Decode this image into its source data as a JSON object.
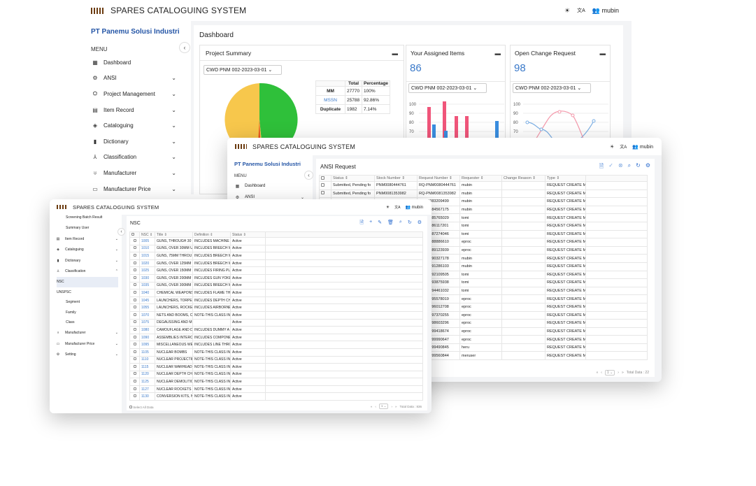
{
  "app": {
    "title": "SPARES CATALOGUING SYSTEM",
    "user": "mubin",
    "theme_icon": "☀",
    "lang_icon": "文A",
    "company": "PT Panemu Solusi Industri",
    "menu_label": "MENU"
  },
  "win1": {
    "page_title": "Dashboard",
    "sidebar": [
      {
        "label": "Dashboard",
        "icon": "▦"
      },
      {
        "label": "ANSI",
        "icon": "⚙",
        "chev": "⌄"
      },
      {
        "label": "Project Management",
        "icon": "⛭",
        "chev": "⌄"
      },
      {
        "label": "Item Record",
        "icon": "▤",
        "chev": "⌄"
      },
      {
        "label": "Cataloguing",
        "icon": "◈",
        "chev": "⌄"
      },
      {
        "label": "Dictionary",
        "icon": "▮",
        "chev": "⌄"
      },
      {
        "label": "Classification",
        "icon": "⅄",
        "chev": "⌄"
      },
      {
        "label": "Manufacturer",
        "icon": "♅",
        "chev": "⌄"
      },
      {
        "label": "Manufacturer Price",
        "icon": "▭",
        "chev": "⌄"
      }
    ],
    "project_summary": {
      "title": "Project Summary",
      "select": "CWO PNM 002-2023-03-01",
      "table": {
        "headers": [
          "",
          "Total",
          "Percentage"
        ],
        "rows": [
          [
            "MM",
            "27770",
            "100%"
          ],
          [
            "MSSN",
            "25788",
            "92.86%"
          ],
          [
            "Duplicate",
            "1982",
            "7.14%"
          ]
        ]
      },
      "pie": {
        "values": [
          92.86,
          7.14
        ],
        "colors": [
          "#2fc03a",
          "#f7c74c"
        ]
      }
    },
    "assigned": {
      "title": "Your Assigned Items",
      "count": "86",
      "select": "CWO PNM 002-2023-03-01",
      "yticks": [
        "100",
        "90",
        "80",
        "70",
        "60",
        "50"
      ]
    },
    "change": {
      "title": "Open Change Request",
      "count": "98",
      "select": "CWO PNM 002-2023-03-01",
      "yticks": [
        "100",
        "90",
        "80",
        "70",
        "60",
        "50"
      ]
    }
  },
  "win2": {
    "sidebar": [
      {
        "label": "Dashboard",
        "icon": "▦"
      },
      {
        "label": "ANSI",
        "icon": "⚙",
        "chev": "⌄"
      }
    ],
    "title": "ANSI Request",
    "toolbar": [
      "doc-icon",
      "check-icon",
      "cancel-icon",
      "search-icon",
      "refresh-icon",
      "settings-icon"
    ],
    "headers": [
      "",
      "Status",
      "Stock Number",
      "Request Number",
      "Requester",
      "Change Reason",
      "Type"
    ],
    "rows": [
      [
        "Submitted, Pending fo",
        "PNM0080444761",
        "RQ-PNM0080444761",
        "mubin",
        "",
        "REQUEST CREATE MA"
      ],
      [
        "Submitted, Pending fo",
        "PNM0081353982",
        "RQ-PNM0081353982",
        "mubin",
        "",
        "REQUEST CREATE MA"
      ],
      [
        "",
        "",
        "PNM0083209499",
        "mubin",
        "",
        "REQUEST CREATE MA"
      ],
      [
        "",
        "",
        "PNM0084567175",
        "mubin",
        "",
        "REQUEST CREATE MA"
      ],
      [
        "",
        "",
        "PNM0085765029",
        "tomi",
        "",
        "REQUEST CREATE MA"
      ],
      [
        "",
        "",
        "PNM0086117201",
        "tomi",
        "",
        "REQUEST CREATE MA"
      ],
      [
        "",
        "",
        "PNM0087274046",
        "tomi",
        "",
        "REQUEST CREATE MA"
      ],
      [
        "",
        "",
        "PNM0088886610",
        "eproc",
        "",
        "REQUEST CREATE MA"
      ],
      [
        "",
        "",
        "PNM0089123939",
        "eproc",
        "",
        "REQUEST CREATE MA"
      ],
      [
        "",
        "",
        "PNM0090327178",
        "mubin",
        "",
        "REQUEST CREATE MA"
      ],
      [
        "",
        "",
        "PNM0091286103",
        "mubin",
        "",
        "REQUEST CREATE MA"
      ],
      [
        "",
        "",
        "PNM0092109505",
        "tomi",
        "",
        "REQUEST CREATE MA"
      ],
      [
        "",
        "",
        "PNM0093875938",
        "tomi",
        "",
        "REQUEST CREATE MA"
      ],
      [
        "",
        "",
        "PNM0094461032",
        "tomi",
        "",
        "REQUEST CREATE MA"
      ],
      [
        "",
        "",
        "PNM0095578019",
        "eproc",
        "",
        "REQUEST CREATE MA"
      ],
      [
        "",
        "",
        "PNM0096012708",
        "eproc",
        "",
        "REQUEST CREATE MA"
      ],
      [
        "",
        "",
        "PNM0097370255",
        "eproc",
        "",
        "REQUEST CREATE MA"
      ],
      [
        "",
        "",
        "PNM0098603296",
        "eproc",
        "",
        "REQUEST CREATE MA"
      ],
      [
        "",
        "",
        "PNM0099418674",
        "eproc",
        "",
        "REQUEST CREATE MA"
      ],
      [
        "",
        "",
        "PNM0099990647",
        "eproc",
        "",
        "REQUEST CREATE MA"
      ],
      [
        "",
        "",
        "PNM0099490845",
        "heru",
        "",
        "REQUEST CREATE MA"
      ],
      [
        "",
        "",
        "PNM0099560844",
        "meruser",
        "",
        "REQUEST CREATE MA"
      ]
    ],
    "pager": {
      "page": "1",
      "total": "Total Data : 22"
    }
  },
  "win3": {
    "sidebar_top": [
      "Screening Batch Result",
      "Summary User"
    ],
    "sidebar": [
      {
        "label": "Item Record",
        "icon": "▤",
        "chev": "⌄"
      },
      {
        "label": "Cataloguing",
        "icon": "◈",
        "chev": "⌄"
      },
      {
        "label": "Dictionary",
        "icon": "▮",
        "chev": "⌄"
      },
      {
        "label": "Classification",
        "icon": "⅄",
        "chev": "⌃"
      }
    ],
    "sub": [
      {
        "label": "NSC",
        "level": 1,
        "active": true
      },
      {
        "label": "UNSPSC",
        "level": 1
      },
      {
        "label": "Segment",
        "level": 2
      },
      {
        "label": "Family",
        "level": 2
      },
      {
        "label": "Class",
        "level": 2
      }
    ],
    "sidebar_bottom": [
      {
        "label": "Manufacturer",
        "icon": "♅",
        "chev": "⌄"
      },
      {
        "label": "Manufacturer Price",
        "icon": "▭",
        "chev": "⌄"
      },
      {
        "label": "Setting",
        "icon": "⚙",
        "chev": "⌄"
      }
    ],
    "title": "NSC",
    "headers": [
      "",
      "NSC",
      "Title",
      "Definition",
      "Status"
    ],
    "rows": [
      [
        "1005",
        "GUNS, THROUGH 30",
        "INCLUDES MACHINE",
        "Active"
      ],
      [
        "1010",
        "GUNS, OVER 30MM U",
        "INCLUDES BREECH M",
        "Active"
      ],
      [
        "1015",
        "GUNS, 75MM THROU",
        "INCLUDES BREECH M",
        "Active"
      ],
      [
        "1020",
        "GUNS, OVER 125MM",
        "INCLUDES BREECH M",
        "Active"
      ],
      [
        "1025",
        "GUNS, OVER 150MM",
        "INCLUDES FIRING PL",
        "Active"
      ],
      [
        "1030",
        "GUNS, OVER 200MM",
        "INCLUDES GUN YOKE",
        "Active"
      ],
      [
        "1035",
        "GUNS, OVER 300MM",
        "INCLUDES BREECH M",
        "Active"
      ],
      [
        "1040",
        "CHEMICAL WEAPONS",
        "INCLUDES FLAME TH",
        "Active"
      ],
      [
        "1045",
        "LAUNCHERS, TORPE",
        "INCLUDES DEPTH CH",
        "Active"
      ],
      [
        "1055",
        "LAUNCHERS, ROCKE",
        "INCLUDES AIRBORNE",
        "Active"
      ],
      [
        "1070",
        "NETS AND BOOMS, C",
        "NOTE-THIS CLASS IN",
        "Active"
      ],
      [
        "1075",
        "DEGAUSSING AND M",
        "",
        "Active"
      ],
      [
        "1080",
        "CAMOUFLAGE AND D",
        "INCLUDES DUMMY A",
        "Active"
      ],
      [
        "1090",
        "ASSEMBLIES INTERC",
        "INCLUDES COMPONE",
        "Active"
      ],
      [
        "1095",
        "MISCELLANEOUS WE",
        "INCLUDES LINE THRO",
        "Active"
      ],
      [
        "1105",
        "NUCLEAR BOMBS",
        "NOTE-THIS CLASS IN",
        "Active"
      ],
      [
        "1110",
        "NUCLEAR PROJECTIL",
        "NOTE-THIS CLASS IN",
        "Active"
      ],
      [
        "1115",
        "NUCLEAR WARHEAD",
        "NOTE-THIS CLASS IN",
        "Active"
      ],
      [
        "1120",
        "NUCLEAR DEPTH CH",
        "NOTE-THIS CLASS IN",
        "Active"
      ],
      [
        "1125",
        "NUCLEAR DEMOLITIC",
        "NOTE-THIS CLASS IN",
        "Active"
      ],
      [
        "1127",
        "NUCLEAR ROCKETS",
        "NOTE-THIS CLASS IN",
        "Active"
      ],
      [
        "1130",
        "CONVERSION KITS, N",
        "NOTE-THIS CLASS IN",
        "Active"
      ]
    ],
    "footer_select": "Select All Data",
    "pager": {
      "page": "1",
      "total": "Total Data : 836"
    }
  }
}
